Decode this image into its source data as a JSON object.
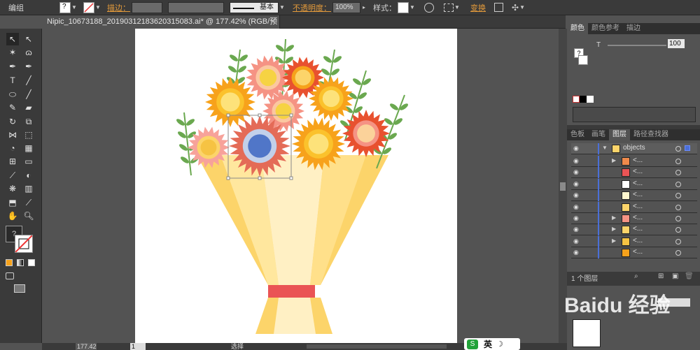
{
  "control_bar": {
    "selection_label": "编组",
    "stroke_label": "描边：",
    "stroke_profile": "基本",
    "opacity_label": "不透明度：",
    "opacity_value": "100%",
    "style_label": "样式：",
    "transform_label": "变换"
  },
  "document_tab": {
    "title": "Nipic_10673188_20190312183620315083.ai* @ 177.42% (RGB/预览)"
  },
  "right_panel": {
    "top_tabs": [
      "颜色",
      "颜色参考",
      "描边"
    ],
    "tint_label": "T",
    "tint_value": "100",
    "layer_tabs": [
      "色板",
      "画笔",
      "图层",
      "路径查找器"
    ],
    "layer_name": "objects",
    "sublayer_placeholder": "<...",
    "layer_count": "1 个图层"
  },
  "status_bar": {
    "zoom": "177.42",
    "artboard_num": "1",
    "tool_status": "选择"
  },
  "ime_bar": {
    "label": "英"
  },
  "colors": {
    "ui_dark": "#3a3a3a",
    "ui_mid": "#535353",
    "accent_orange": "#e39a3b",
    "layer_blue": "#4b6fd8",
    "wrap_yellow": "#fcd86a",
    "ribbon_red": "#ea5455"
  }
}
